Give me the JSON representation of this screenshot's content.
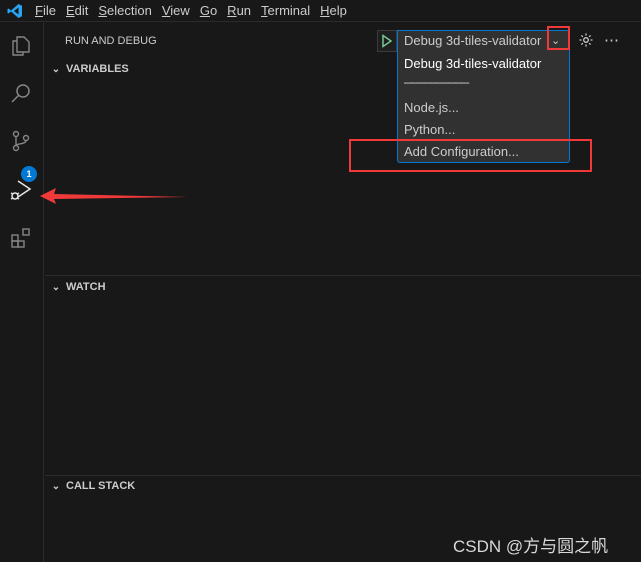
{
  "menubar": {
    "items": [
      "File",
      "Edit",
      "Selection",
      "View",
      "Go",
      "Run",
      "Terminal",
      "Help"
    ]
  },
  "activity_bar": {
    "items": [
      "explorer-icon",
      "search-icon",
      "source-control-icon",
      "run-debug-icon",
      "extensions-icon"
    ],
    "scm_badge": "1",
    "accent": "#0078d4"
  },
  "panel": {
    "title": "RUN AND DEBUG",
    "config_select": "Debug 3d-tiles-validator",
    "dropdown": {
      "options": [
        "Debug 3d-tiles-validator",
        "──────────",
        "Node.js...",
        "Python...",
        "Add Configuration..."
      ]
    },
    "sections": [
      "VARIABLES",
      "WATCH",
      "CALL STACK"
    ]
  },
  "annotation_color": "#f03a3a",
  "watermark": "CSDN @方与圆之帆"
}
